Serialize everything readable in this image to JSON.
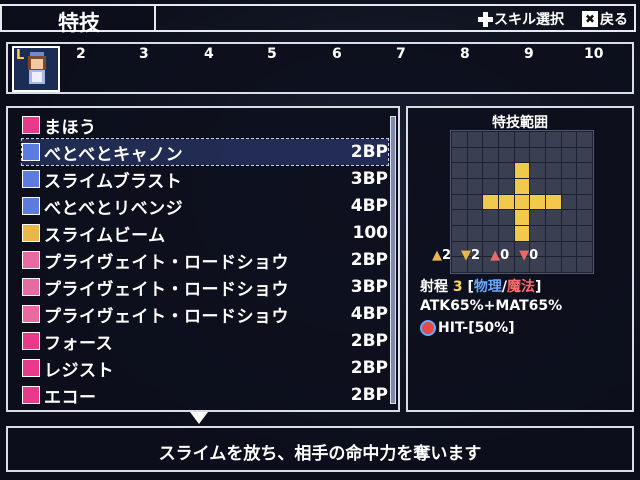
{
  "header": {
    "title": "特技",
    "skill_select_label": "スキル選択",
    "back_label": "戻る",
    "back_button_glyph": "✖"
  },
  "party": {
    "leader_badge": "L",
    "slots": [
      "2",
      "3",
      "4",
      "5",
      "6",
      "7",
      "8",
      "9",
      "10"
    ]
  },
  "skills": {
    "category": "まほう",
    "selected_index": 0,
    "items": [
      {
        "name": "べとべとキャノン",
        "cost": "2BP",
        "icon": "orb-icon",
        "color": "#5b7be0"
      },
      {
        "name": "スライムブラスト",
        "cost": "3BP",
        "icon": "orb-icon",
        "color": "#5b7be0"
      },
      {
        "name": "べとべとリベンジ",
        "cost": "4BP",
        "icon": "orb-icon",
        "color": "#5b7be0"
      },
      {
        "name": "スライムビーム",
        "cost": "100",
        "icon": "beam-icon",
        "color": "#e8b84a"
      },
      {
        "name": "プライヴェイト・ロードショウ",
        "cost": "2BP",
        "icon": "note-icon",
        "color": "#e86aa0"
      },
      {
        "name": "プライヴェイト・ロードショウ",
        "cost": "3BP",
        "icon": "note-plus1-icon",
        "color": "#e86aa0"
      },
      {
        "name": "プライヴェイト・ロードショウ",
        "cost": "4BP",
        "icon": "note-plus2-icon",
        "color": "#e86aa0"
      },
      {
        "name": "フォース",
        "cost": "2BP",
        "icon": "vo-icon",
        "color": "#e83a8a"
      },
      {
        "name": "レジスト",
        "cost": "2BP",
        "icon": "vo-icon",
        "color": "#e83a8a"
      },
      {
        "name": "エコー",
        "cost": "2BP",
        "icon": "vo-icon",
        "color": "#e83a8a"
      }
    ]
  },
  "range_panel": {
    "title": "特技範囲",
    "stats": [
      {
        "icon": "up-arrow-icon",
        "value": "2"
      },
      {
        "icon": "down-arrow-icon",
        "value": "2"
      },
      {
        "icon": "left-arrow-icon",
        "value": "0"
      },
      {
        "icon": "right-arrow-icon",
        "value": "0"
      }
    ],
    "range_label": "射程",
    "range_value": "3",
    "type_open": "[",
    "type_physical": "物理",
    "type_sep": "/",
    "type_magic": "魔法",
    "type_close": "]",
    "atk_mat": "ATK65%+MAT65%",
    "hit": "HIT-[50%]",
    "colors": {
      "range_value": "#ffd54a",
      "physical": "#6aa8ff",
      "magic": "#ff6a6a",
      "highlight": "#f2c94c"
    }
  },
  "description": "スライムを放ち、相手の命中力を奪います"
}
